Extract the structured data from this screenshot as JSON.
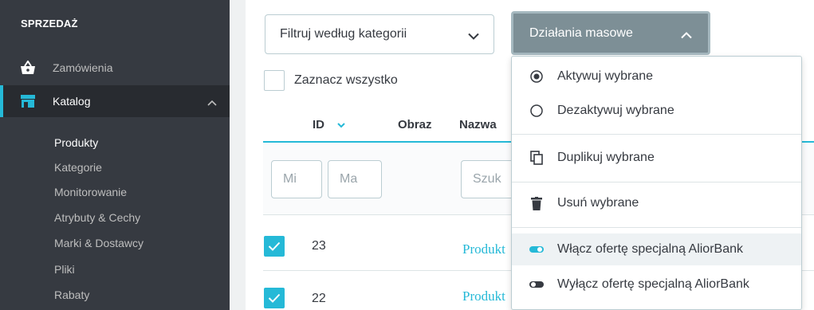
{
  "sidebar": {
    "section_title": "SPRZEDAŻ",
    "orders_label": "Zamówienia",
    "catalog_label": "Katalog",
    "catalog_subitems": [
      "Produkty",
      "Kategorie",
      "Monitorowanie",
      "Atrybuty & Cechy",
      "Marki & Dostawcy",
      "Pliki",
      "Rabaty"
    ],
    "active_subitem": "Produkty",
    "accent_color": "#25b9d7"
  },
  "toolbar": {
    "filter_button_label": "Filtruj według kategorii",
    "bulk_button_label": "Działania masowe"
  },
  "table": {
    "select_all_label": "Zaznacz wszystko",
    "headers": {
      "id": "ID",
      "image": "Obraz",
      "name": "Nazwa"
    },
    "filters": {
      "min_placeholder": "Mi",
      "max_placeholder": "Ma",
      "search_placeholder": "Szuk"
    },
    "rows": [
      {
        "id": "23",
        "name": "Produkt",
        "checked": true
      },
      {
        "id": "22",
        "name": "Produkt",
        "checked": true
      }
    ]
  },
  "bulk_menu": {
    "items": [
      {
        "label": "Aktywuj wybrane",
        "icon": "radio-checked-icon"
      },
      {
        "label": "Dezaktywuj wybrane",
        "icon": "radio-unchecked-icon"
      },
      {
        "label": "Duplikuj wybrane",
        "icon": "copy-icon"
      },
      {
        "label": "Usuń wybrane",
        "icon": "trash-icon"
      },
      {
        "label": "Włącz ofertę specjalną AliorBank",
        "icon": "toggle-on-icon"
      },
      {
        "label": "Wyłącz ofertę specjalną AliorBank",
        "icon": "toggle-off-icon"
      }
    ]
  }
}
